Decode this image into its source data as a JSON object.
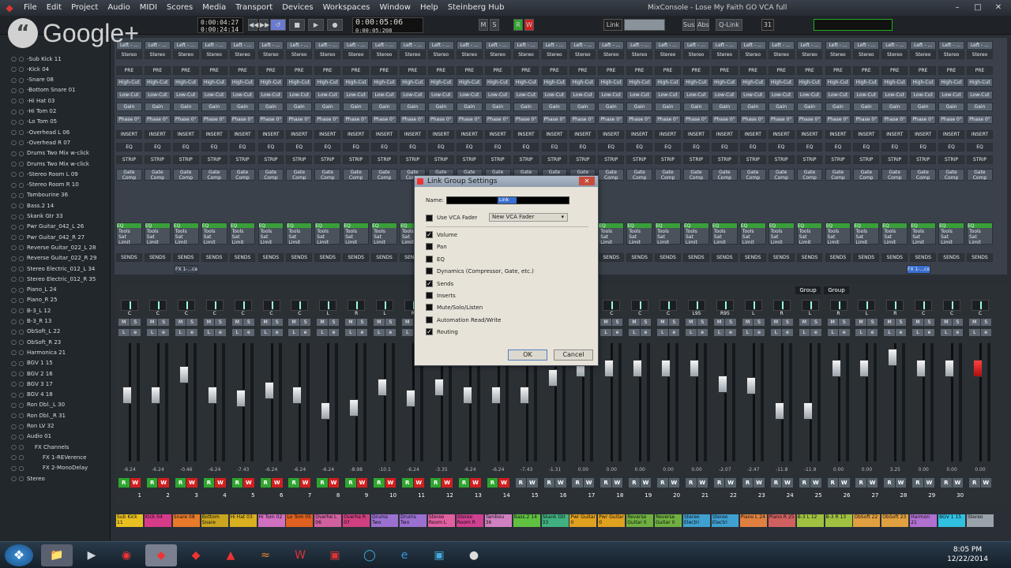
{
  "menu": {
    "items": [
      "File",
      "Edit",
      "Project",
      "Audio",
      "MIDI",
      "Scores",
      "Media",
      "Transport",
      "Devices",
      "Workspaces",
      "Window",
      "Help",
      "Steinberg Hub"
    ],
    "title": "MixConsole - Lose My Faith GO VCA full"
  },
  "toolbar": {
    "config_label": "Configurations",
    "preset_label": "Ricks",
    "time_a": "0:00:04:27",
    "time_b": "0:00:24:14",
    "time_main": "0:00:05:06",
    "time_sub": "0:00:05:208",
    "link_label": "Link",
    "qlink": "Q-Link",
    "sus": "Sus",
    "abs": "Abs",
    "count": "31"
  },
  "overlay": {
    "brand": "Google+"
  },
  "tracks": [
    "-Sub Kick 11",
    "-Kick 04",
    "-Snare 08",
    "-Bottom Snare 01",
    "-Hi Hat 03",
    "-Hi Tom 02",
    "-Lo Tom 05",
    "-Overhead L 06",
    "-Overhead R 07",
    "Drums Two Mix w-click",
    "Drums Two Mix w-click",
    "-Stereo Room L 09",
    "-Stereo Room R 10",
    "Tambourine 36",
    "Bass.2 14",
    "Skank Gtr 33",
    "Pwr Guitar_042_L 26",
    "Pwr Guitar_042_R 27",
    "Reverse Guitar_022_L 28",
    "Reverse Guitar_022_R 29",
    "Stereo Electric_012_L 34",
    "Stereo Electric_012_R 35",
    "Piano_L 24",
    "Piano_R 25",
    "B-3_L 12",
    "B-3_R 13",
    "ObSoft_L 22",
    "ObSoft_R 23",
    "Harmonica 21",
    "BGV 1 15",
    "BGV 2 16",
    "BGV 3 17",
    "BGV 4 18",
    "Ron Dbl._L 30",
    "Ron Dbl._R 31",
    "Ron LV 32",
    "Audio 01",
    "FX Channels",
    "FX 1-REVerence",
    "FX 2-MonoDelay",
    "Stereo"
  ],
  "racks": {
    "pre": "PRE",
    "highcut": "High-Cut",
    "lowcut": "Low-Cut",
    "gain": "Gain",
    "phase": "Phase 0°",
    "insert": "INSERT",
    "eq": "EQ",
    "strip": "STRIP",
    "gate1": "Gate",
    "gate2": "Comp",
    "tools": [
      "EQ",
      "Tools",
      "Sat",
      "Limit"
    ],
    "sends": "SENDS",
    "fx": "FX 1-...ce",
    "stereo": "Stereo",
    "shift": "Left - ...",
    "labels": [
      "Gate",
      "Comp"
    ]
  },
  "faders": {
    "values": [
      "-6.24",
      "-6.24",
      "-0.46",
      "-6.24",
      "-7.43",
      "-6.24",
      "-6.24",
      "-6.24",
      "-8.98",
      "-10.1",
      "-6.24",
      "-3.35",
      "-6.24",
      "-6.24",
      "-7.43",
      "-1.31",
      "0.00",
      "0.00",
      "0.00",
      "0.00",
      "0.00",
      "-2.07",
      "-2.47",
      "-11.8",
      "-11.9",
      "0.00",
      "0.00",
      "3.25",
      "0.00",
      "0.00",
      "0.00"
    ],
    "pans": [
      "C",
      "C",
      "C",
      "C",
      "C",
      "C",
      "C",
      "L",
      "R",
      "L",
      "R",
      "C",
      "C",
      "C",
      "C",
      "C",
      "C",
      "C",
      "C",
      "C",
      "L95",
      "R95",
      "L",
      "R",
      "L",
      "R",
      "L",
      "R",
      "C",
      "C",
      "C"
    ],
    "groups": [
      "Group",
      "Group"
    ],
    "numbers": [
      "1",
      "2",
      "3",
      "4",
      "5",
      "6",
      "7",
      "8",
      "9",
      "10",
      "11",
      "12",
      "13",
      "14",
      "15",
      "16",
      "17",
      "18",
      "19",
      "20",
      "21",
      "22",
      "23",
      "24",
      "25",
      "26",
      "27",
      "28",
      "29",
      "30"
    ]
  },
  "channel_names": [
    "Sub Kick 11",
    "Kick 04",
    "Snare 08",
    "Bottom Snare",
    "Hi Hat 03",
    "Hi Tom 02",
    "Lo Tom 05",
    "Overhe L 06",
    "Overhe R 07",
    "Drums Two",
    "Drums Two",
    "Stereo Room L",
    "Stereo Room R",
    "Tambou 36",
    "Bass.2 14",
    "Skank Gtr 33",
    "Pwr Guitar 0",
    "Pwr Guitar 0",
    "Reverse Guitar 0",
    "Reverse Guitar 0",
    "Stereo Electri",
    "Stereo Electri",
    "Piano L 24",
    "Piano R 25",
    "B-3 L 12",
    "B-3 R 13",
    "ObSoft 22",
    "ObSoft 23",
    "Harmon 21",
    "BGV 1 15",
    "Stereo"
  ],
  "channel_colors": [
    "#e8c020",
    "#d83a8a",
    "#e87a2a",
    "#c9a520",
    "#d8b020",
    "#d070c0",
    "#e06020",
    "#d060a0",
    "#d04080",
    "#9a70d0",
    "#9a70d0",
    "#e060a0",
    "#d04090",
    "#d080c0",
    "#60c040",
    "#40b080",
    "#e0a020",
    "#e0a020",
    "#70b040",
    "#70b040",
    "#40a0d0",
    "#40a0d0",
    "#e08040",
    "#d06060",
    "#a0c040",
    "#a0c040",
    "#e0a040",
    "#e0a040",
    "#b070d0",
    "#30c0e0",
    "#9aa3ab"
  ],
  "dialog": {
    "title": "Link Group Settings",
    "name_label": "Name:",
    "name_value": "Link",
    "use_vca": "Use VCA Fader",
    "vca_value": "New VCA Fader",
    "options": [
      {
        "label": "Volume",
        "checked": true
      },
      {
        "label": "Pan",
        "checked": false
      },
      {
        "label": "EQ",
        "checked": false
      },
      {
        "label": "Dynamics (Compressor, Gate, etc.)",
        "checked": false
      },
      {
        "label": "Sends",
        "checked": true
      },
      {
        "label": "Inserts",
        "checked": false
      },
      {
        "label": "Mute/Solo/Listen",
        "checked": false
      },
      {
        "label": "Automation Read/Write",
        "checked": false
      },
      {
        "label": "Routing",
        "checked": true
      }
    ],
    "ok": "OK",
    "cancel": "Cancel"
  },
  "taskbar": {
    "time": "8:05 PM",
    "date": "12/22/2014"
  }
}
